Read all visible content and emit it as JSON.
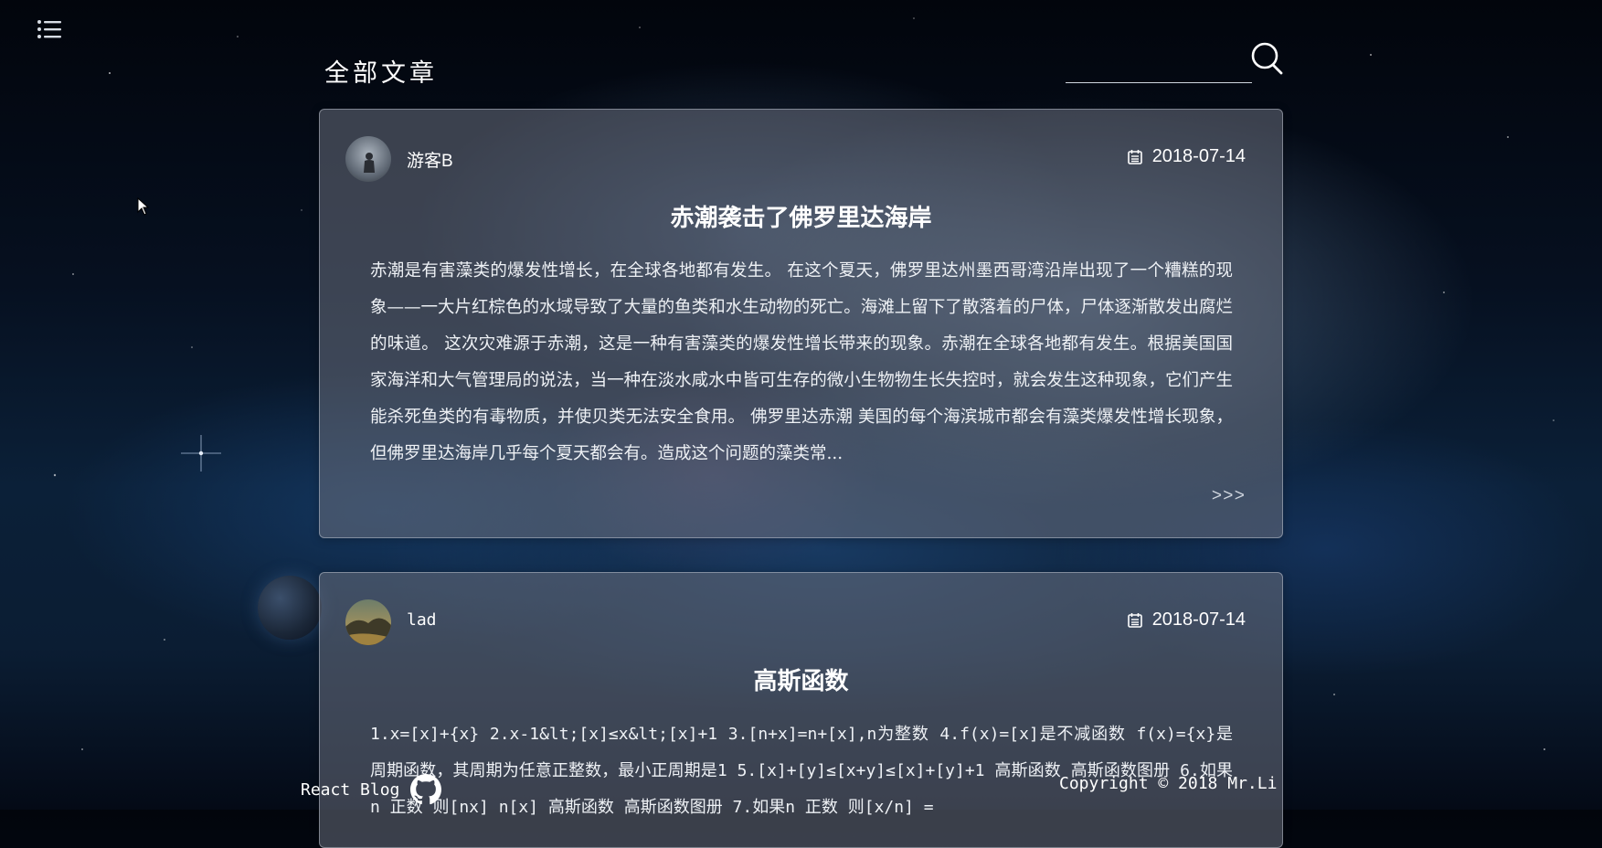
{
  "header": {
    "title": "全部文章",
    "search": {
      "value": "",
      "placeholder": ""
    }
  },
  "posts": [
    {
      "author": "游客B",
      "date": "2018-07-14",
      "title": "赤潮袭击了佛罗里达海岸",
      "excerpt": "赤潮是有害藻类的爆发性增长，在全球各地都有发生。  在这个夏天，佛罗里达州墨西哥湾沿岸出现了一个糟糕的现象——一大片红棕色的水域导致了大量的鱼类和水生动物的死亡。海滩上留下了散落着的尸体，尸体逐渐散发出腐烂的味道。  这次灾难源于赤潮，这是一种有害藻类的爆发性增长带来的现象。赤潮在全球各地都有发生。根据美国国家海洋和大气管理局的说法，当一种在淡水咸水中皆可生存的微小生物物生长失控时，就会发生这种现象，它们产生能杀死鱼类的有毒物质，并使贝类无法安全食用。  佛罗里达赤潮  美国的每个海滨城市都会有藻类爆发性增长现象，但佛罗里达海岸几乎每个夏天都会有。造成这个问题的藻类常...",
      "more": ">>>"
    },
    {
      "author": "lad",
      "date": "2018-07-14",
      "title": "高斯函数",
      "excerpt": "1.x=[x]+{x} 2.x-1&lt;[x]≤x&lt;[x]+1 3.[n+x]=n+[x],n为整数 4.f(x)=[x]是不减函数 f(x)={x}是周期函数，其周期为任意正整数，最小正周期是1 5.[x]+[y]≤[x+y]≤[x]+[y]+1 高斯函数 高斯函数图册 6.如果n 正数 则[nx] n[x] 高斯函数 高斯函数图册 7.如果n 正数 则[x/n] ="
    }
  ],
  "footer": {
    "brand": "React Blog",
    "copyright": "Copyright © 2018 Mr.Li"
  },
  "icons": {
    "menu": "menu-icon",
    "search": "search-icon",
    "calendar": "calendar-icon",
    "github": "github-icon"
  }
}
